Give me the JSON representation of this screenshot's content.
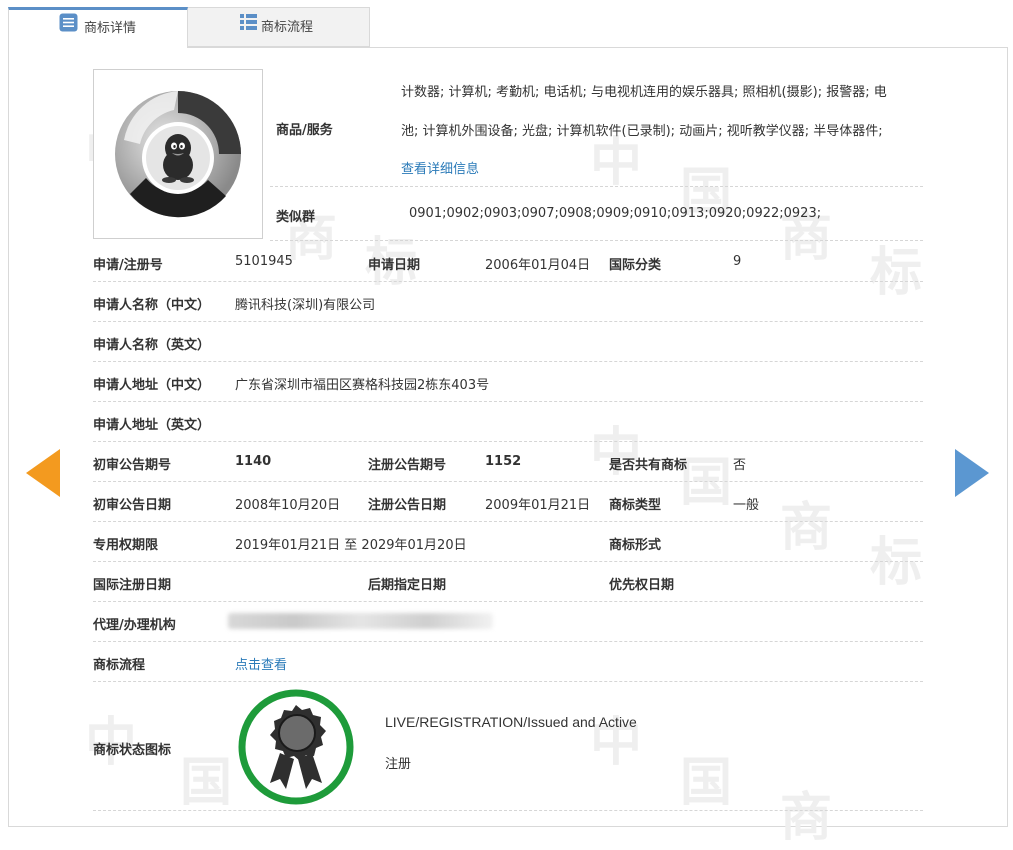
{
  "tabs": [
    {
      "label": "商标详情",
      "icon": "list-icon",
      "active": true
    },
    {
      "label": "商标流程",
      "icon": "grid-list-icon",
      "active": false
    }
  ],
  "goods": {
    "label": "商品/服务",
    "line1": "计数器; 计算机; 考勤机; 电话机; 与电视机连用的娱乐器具; 照相机(摄影); 报警器; 电",
    "line2": "池; 计算机外围设备; 光盘; 计算机软件(已录制); 动画片; 视听教学仪器; 半导体器件;",
    "more_link": "查看详细信息"
  },
  "similar_group": {
    "label": "类似群",
    "value": "0901;0902;0903;0907;0908;0909;0910;0913;0920;0922;0923;"
  },
  "fields": {
    "reg_no_label": "申请/注册号",
    "reg_no": "5101945",
    "apply_date_label": "申请日期",
    "apply_date": "2006年01月04日",
    "intl_class_label": "国际分类",
    "intl_class": "9",
    "applicant_cn_label": "申请人名称（中文）",
    "applicant_cn": "腾讯科技(深圳)有限公司",
    "applicant_en_label": "申请人名称（英文）",
    "applicant_en": "",
    "address_cn_label": "申请人地址（中文）",
    "address_cn": "广东省深圳市福田区赛格科技园2栋东403号",
    "address_en_label": "申请人地址（英文）",
    "address_en": "",
    "prelim_issue_label": "初审公告期号",
    "prelim_issue": "1140",
    "reg_issue_label": "注册公告期号",
    "reg_issue": "1152",
    "shared_label": "是否共有商标",
    "shared": "否",
    "prelim_date_label": "初审公告日期",
    "prelim_date": "2008年10月20日",
    "reg_date_label": "注册公告日期",
    "reg_date": "2009年01月21日",
    "tm_type_label": "商标类型",
    "tm_type": "一般",
    "exclusive_label": "专用权期限",
    "exclusive": "2019年01月21日 至 2029年01月20日",
    "tm_form_label": "商标形式",
    "tm_form": "",
    "intl_reg_date_label": "国际注册日期",
    "intl_reg_date": "",
    "later_designation_label": "后期指定日期",
    "later_designation": "",
    "priority_date_label": "优先权日期",
    "priority_date": "",
    "agent_label": "代理/办理机构",
    "process_label": "商标流程",
    "process_link": "点击查看",
    "status_icon_label": "商标状态图标",
    "status_en": "LIVE/REGISTRATION/Issued and Active",
    "status_cn": "注册"
  },
  "watermark_chars": [
    "中",
    "国",
    "商",
    "标"
  ],
  "colors": {
    "tab_accent": "#5b8fc7",
    "link": "#2a7ab8",
    "left_arrow": "#f39a1f",
    "right_arrow": "#5b97d1",
    "status_ring": "#1e9b3a"
  }
}
